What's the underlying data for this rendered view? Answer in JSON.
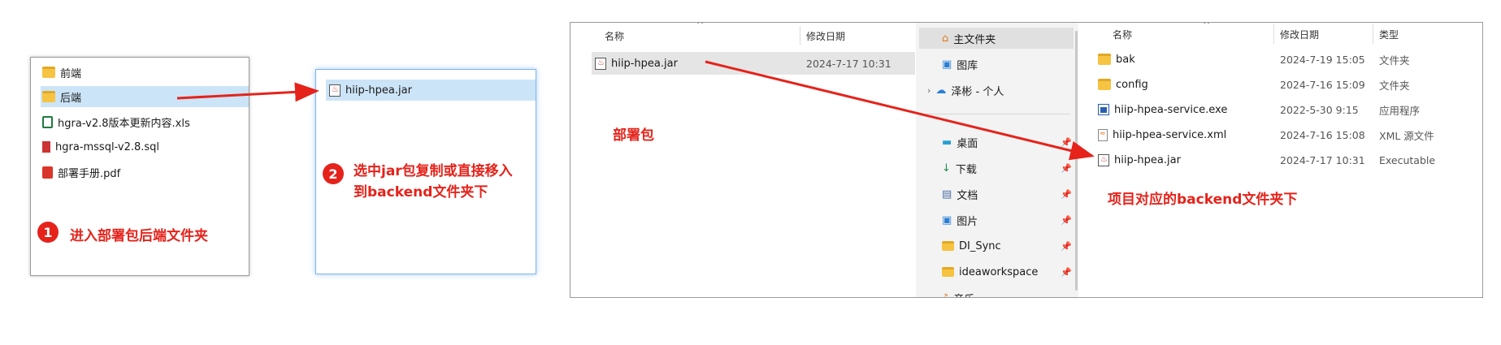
{
  "left_window": {
    "items": [
      {
        "name": "前端",
        "type": "folder"
      },
      {
        "name": "后端",
        "type": "folder",
        "selected": true
      },
      {
        "name": "hgra-v2.8版本更新内容.xls",
        "type": "xls"
      },
      {
        "name": "hgra-mssql-v2.8.sql",
        "type": "sql"
      },
      {
        "name": "部署手册.pdf",
        "type": "pdf"
      }
    ]
  },
  "mid_window": {
    "items": [
      {
        "name": "hiip-hpea.jar",
        "type": "jar",
        "selected": true
      }
    ]
  },
  "annotations": {
    "step1_num": "1",
    "step1_text": "进入部署包后端文件夹",
    "step2_num": "2",
    "step2_line1": "选中jar包复制或直接移入",
    "step2_line2": "到backend文件夹下",
    "deploy_pkg": "部署包",
    "backend_folder": "项目对应的backend文件夹下"
  },
  "explorer_left": {
    "col_name": "名称",
    "col_date": "修改日期",
    "file": {
      "name": "hiip-hpea.jar",
      "date": "2024-7-17 10:31"
    }
  },
  "nav_pane": {
    "items": [
      {
        "label": "主文件夹",
        "icon": "home-icon",
        "selected": true
      },
      {
        "label": "图库",
        "icon": "gallery-icon"
      },
      {
        "label": "泽彬 - 个人",
        "icon": "cloud-icon",
        "expandable": true
      },
      {
        "label": "桌面",
        "icon": "desktop-icon",
        "pinned": true
      },
      {
        "label": "下载",
        "icon": "download-icon",
        "pinned": true
      },
      {
        "label": "文档",
        "icon": "document-icon",
        "pinned": true
      },
      {
        "label": "图片",
        "icon": "picture-icon",
        "pinned": true
      },
      {
        "label": "DI_Sync",
        "icon": "folder-icon",
        "pinned": true
      },
      {
        "label": "ideaworkspace",
        "icon": "folder-icon",
        "pinned": true
      },
      {
        "label": "音乐",
        "icon": "music-icon",
        "pinned": false
      }
    ]
  },
  "explorer_right": {
    "col_name": "名称",
    "col_date": "修改日期",
    "col_type": "类型",
    "files": [
      {
        "name": "bak",
        "date": "2024-7-19 15:05",
        "type": "文件夹",
        "icon": "folder"
      },
      {
        "name": "config",
        "date": "2024-7-16 15:09",
        "type": "文件夹",
        "icon": "folder"
      },
      {
        "name": "hiip-hpea-service.exe",
        "date": "2022-5-30 9:15",
        "type": "应用程序",
        "icon": "exe"
      },
      {
        "name": "hiip-hpea-service.xml",
        "date": "2024-7-16 15:08",
        "type": "XML 源文件",
        "icon": "xml"
      },
      {
        "name": "hiip-hpea.jar",
        "date": "2024-7-17 10:31",
        "type": "Executable",
        "icon": "jar"
      }
    ]
  },
  "colors": {
    "accent_red": "#e5231b",
    "selection": "#cce4f7"
  }
}
